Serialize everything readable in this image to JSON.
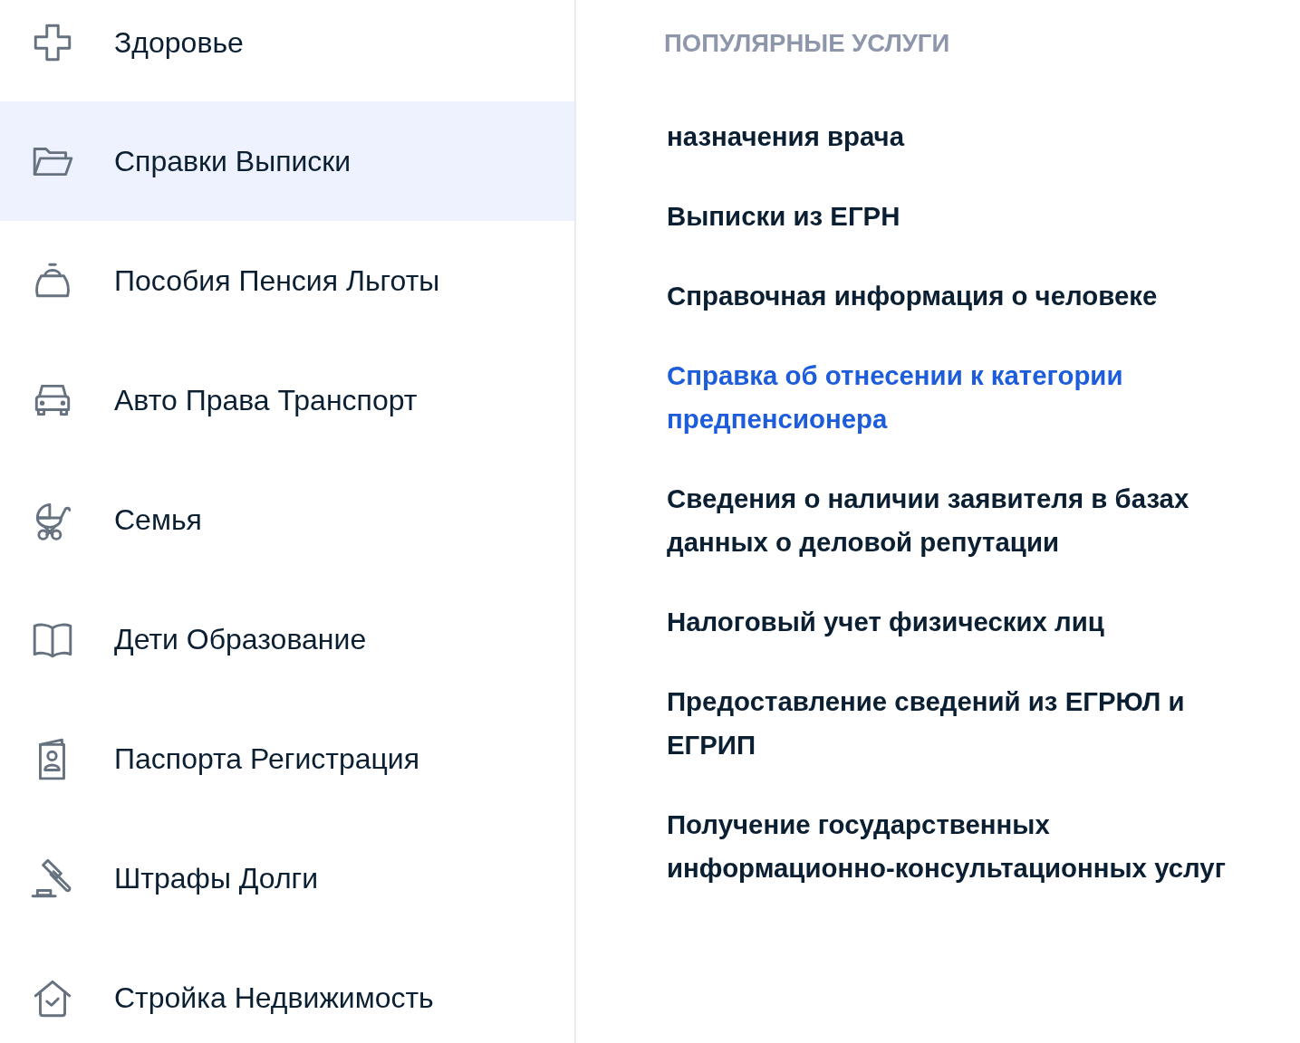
{
  "sidebar": {
    "items": [
      {
        "label": "Здоровье",
        "selected": false
      },
      {
        "label": "Справки Выписки",
        "selected": true
      },
      {
        "label": "Пособия Пенсия Льготы",
        "selected": false
      },
      {
        "label": "Авто Права Транспорт",
        "selected": false
      },
      {
        "label": "Семья",
        "selected": false
      },
      {
        "label": "Дети Образование",
        "selected": false
      },
      {
        "label": "Паспорта Регистрация",
        "selected": false
      },
      {
        "label": "Штрафы Долги",
        "selected": false
      },
      {
        "label": "Стройка Недвижимость",
        "selected": false
      }
    ]
  },
  "popular": {
    "title": "ПОПУЛЯРНЫЕ УСЛУГИ",
    "items": [
      {
        "text": "назначения врача",
        "hovered": false
      },
      {
        "text": "Выписки из ЕГРН",
        "hovered": false
      },
      {
        "text": "Справочная информация о человеке",
        "hovered": false
      },
      {
        "text": "Справка об отнесении к категории предпенсионера",
        "hovered": true
      },
      {
        "text": "Сведения о наличии заявителя в базах данных о деловой репутации",
        "hovered": false
      },
      {
        "text": "Налоговый учет физических лиц",
        "hovered": false
      },
      {
        "text": "Предоставление сведений из ЕГРЮЛ и ЕГРИП",
        "hovered": false
      },
      {
        "text": "Получение государственных информационно-консультационных услуг",
        "hovered": false
      }
    ]
  }
}
